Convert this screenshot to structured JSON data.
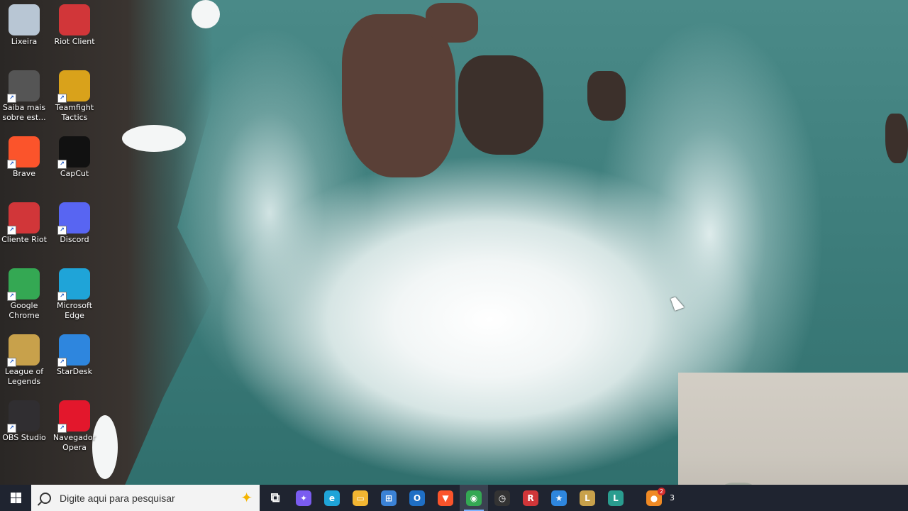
{
  "desktop": {
    "icons": [
      {
        "label": "Lixeira",
        "icon": "recycle-bin-icon",
        "color": "#b8c6d4"
      },
      {
        "label": "Riot Client",
        "icon": "riot-client-icon",
        "color": "#d13639"
      },
      {
        "label": "Saiba mais sobre est...",
        "icon": "learn-more-icon",
        "color": "#555555"
      },
      {
        "label": "Teamfight Tactics",
        "icon": "teamfight-tactics-icon",
        "color": "#d9a21b"
      },
      {
        "label": "Brave",
        "icon": "brave-icon",
        "color": "#fb542b"
      },
      {
        "label": "CapCut",
        "icon": "capcut-icon",
        "color": "#111111"
      },
      {
        "label": "Cliente Riot",
        "icon": "riot-client-icon",
        "color": "#d13639"
      },
      {
        "label": "Discord",
        "icon": "discord-icon",
        "color": "#5865f2"
      },
      {
        "label": "Google Chrome",
        "icon": "chrome-icon",
        "color": "#34a853"
      },
      {
        "label": "Microsoft Edge",
        "icon": "edge-icon",
        "color": "#1fa4d8"
      },
      {
        "label": "League of Legends",
        "icon": "league-of-legends-icon",
        "color": "#c8a14b"
      },
      {
        "label": "StarDesk",
        "icon": "stardesk-icon",
        "color": "#2e86de"
      },
      {
        "label": "OBS Studio",
        "icon": "obs-studio-icon",
        "color": "#302e31"
      },
      {
        "label": "Navegador Opera",
        "icon": "opera-icon",
        "color": "#e3172c"
      }
    ]
  },
  "taskbar": {
    "search_placeholder": "Digite aqui para pesquisar",
    "items": [
      {
        "name": "task-view",
        "icon": "task-view-icon",
        "glyph": "⧉",
        "color": "#1f2430"
      },
      {
        "name": "copilot",
        "icon": "copilot-icon",
        "glyph": "✦",
        "color": "#7a5cf0"
      },
      {
        "name": "edge",
        "icon": "edge-icon",
        "glyph": "e",
        "color": "#1fa4d8"
      },
      {
        "name": "file-explorer",
        "icon": "folder-icon",
        "glyph": "▭",
        "color": "#f2b632"
      },
      {
        "name": "microsoft-store",
        "icon": "store-icon",
        "glyph": "⊞",
        "color": "#3b82d6"
      },
      {
        "name": "outlook",
        "icon": "outlook-icon",
        "glyph": "O",
        "color": "#1f6fc5"
      },
      {
        "name": "brave",
        "icon": "brave-icon",
        "glyph": "▼",
        "color": "#fb542b"
      },
      {
        "name": "chrome",
        "icon": "chrome-icon",
        "glyph": "◉",
        "color": "#34a853",
        "active": true
      },
      {
        "name": "recorder",
        "icon": "recorder-icon",
        "glyph": "◷",
        "color": "#333333"
      },
      {
        "name": "riot-client",
        "icon": "riot-client-icon",
        "glyph": "R",
        "color": "#d13639"
      },
      {
        "name": "stardesk",
        "icon": "stardesk-icon",
        "glyph": "★",
        "color": "#2e86de"
      },
      {
        "name": "league-of-legends",
        "icon": "league-of-legends-icon",
        "glyph": "L",
        "color": "#c8a14b"
      },
      {
        "name": "league-client",
        "icon": "league-of-legends-icon",
        "glyph": "L",
        "color": "#2a9d8f"
      },
      {
        "name": "spacer",
        "icon": "",
        "glyph": "",
        "color": "transparent"
      },
      {
        "name": "firefox-like",
        "icon": "browser-icon",
        "glyph": "●",
        "color": "#f08a24",
        "badge": "2"
      }
    ],
    "tail_text": "3"
  }
}
